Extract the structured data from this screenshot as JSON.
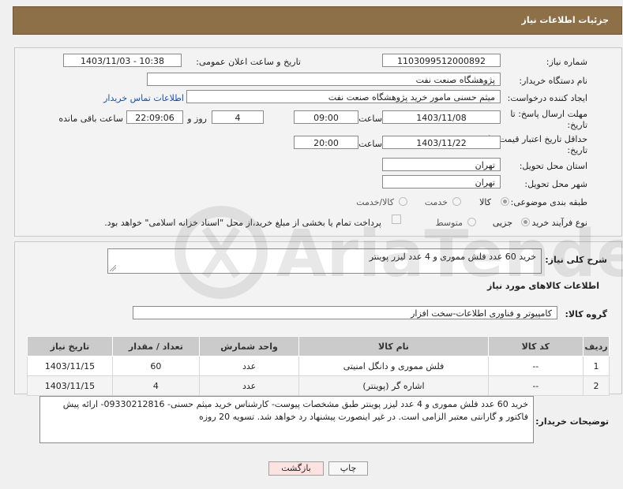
{
  "header": {
    "title": "جزئیات اطلاعات نیاز"
  },
  "form": {
    "need_number_label": "شماره نیاز:",
    "need_number": "1103099512000892",
    "announce_label": "تاریخ و ساعت اعلان عمومی:",
    "announce_value": "1403/11/03 - 10:38",
    "buyer_org_label": "نام دستگاه خریدار:",
    "buyer_org": "پژوهشگاه صنعت نفت",
    "creator_label": "ایجاد کننده درخواست:",
    "creator": "میثم حسنی مامور خرید پژوهشگاه صنعت نفت",
    "contact_link": "اطلاعات تماس خریدار",
    "reply_deadline_label_1": "مهلت ارسال پاسخ: تا",
    "reply_deadline_label_2": "تاریخ:",
    "reply_date": "1403/11/08",
    "time_label": "ساعت",
    "reply_time": "09:00",
    "days_value": "4",
    "days_label": "روز و",
    "remaining_time": "22:09:06",
    "remaining_label": "ساعت باقی مانده",
    "price_validity_label_1": "حداقل تاریخ اعتبار قیمت: تا",
    "price_validity_label_2": "تاریخ:",
    "validity_date": "1403/11/22",
    "validity_time": "20:00",
    "province_label": "استان محل تحویل:",
    "province": "تهران",
    "city_label": "شهر محل تحویل:",
    "city": "تهران",
    "category_label": "طبقه بندی موضوعی:",
    "category_options": [
      "کالا",
      "خدمت",
      "کالا/خدمت"
    ],
    "process_label": "نوع فرآیند خرید :",
    "process_options": [
      "جزیی",
      "متوسط"
    ],
    "payment_note": "پرداخت تمام یا بخشی از مبلغ خرید،از محل \"اسناد خزانه اسلامی\" خواهد بود."
  },
  "description": {
    "label": "شرح کلی نیاز:",
    "value": "خرید 60 عدد فلش مموری و 4 عدد لیزر پوینتر"
  },
  "goods": {
    "section_title": "اطلاعات کالاهای مورد نیاز",
    "group_label": "گروه کالا:",
    "group_value": "کامپیوتر و فناوری اطلاعات-سخت افزار",
    "columns": [
      "ردیف",
      "کد کالا",
      "نام کالا",
      "واحد شمارش",
      "تعداد / مقدار",
      "تاریخ نیاز"
    ],
    "rows": [
      [
        "1",
        "--",
        "فلش مموری و دانگل امنیتی",
        "عدد",
        "60",
        "1403/11/15"
      ],
      [
        "2",
        "--",
        "اشاره گر (پوینتر)",
        "عدد",
        "4",
        "1403/11/15"
      ]
    ]
  },
  "buyer_notes": {
    "label": "توضیحات خریدار:",
    "value": "خرید 60 عدد فلش مموری و 4 عدد لیزر پوینتر طبق مشخصات پیوست- کارشناس خرید میثم حسنی- 09330212816- ارائه پیش فاکتور و گارانتی معتبر الزامی است. در غیر اینصورت پیشنهاد رد خواهد شد. تسویه 20 روزه"
  },
  "buttons": {
    "print": "چاپ",
    "back": "بازگشت"
  },
  "colors": {
    "header_bg": "#8d7047",
    "link": "#1a4fb0",
    "back_button_bg": "#fde2e2"
  }
}
